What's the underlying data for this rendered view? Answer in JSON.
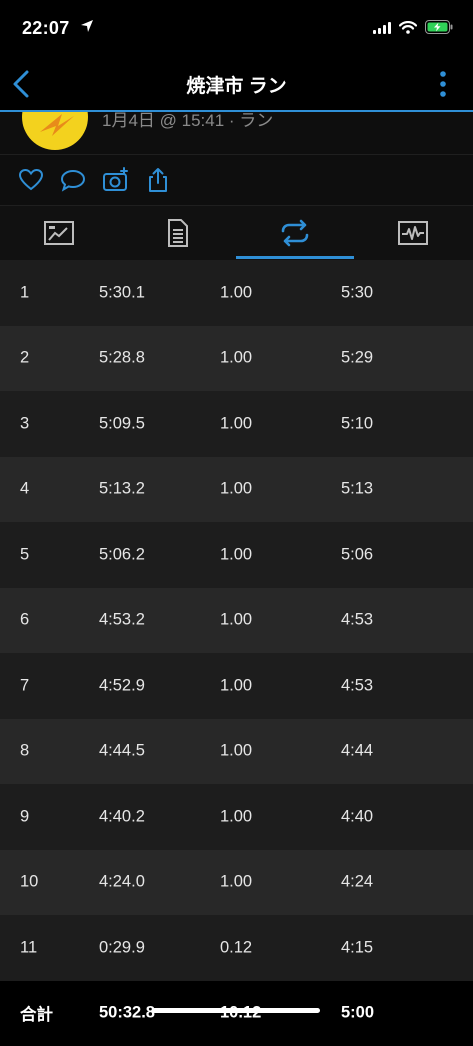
{
  "status": {
    "time": "22:07"
  },
  "nav": {
    "title": "焼津市 ラン"
  },
  "activity": {
    "subtitle": "1月4日 @ 15:41 · ラン"
  },
  "laps": [
    {
      "lap": "1",
      "time": "5:30.1",
      "distance": "1.00",
      "pace": "5:30"
    },
    {
      "lap": "2",
      "time": "5:28.8",
      "distance": "1.00",
      "pace": "5:29"
    },
    {
      "lap": "3",
      "time": "5:09.5",
      "distance": "1.00",
      "pace": "5:10"
    },
    {
      "lap": "4",
      "time": "5:13.2",
      "distance": "1.00",
      "pace": "5:13"
    },
    {
      "lap": "5",
      "time": "5:06.2",
      "distance": "1.00",
      "pace": "5:06"
    },
    {
      "lap": "6",
      "time": "4:53.2",
      "distance": "1.00",
      "pace": "4:53"
    },
    {
      "lap": "7",
      "time": "4:52.9",
      "distance": "1.00",
      "pace": "4:53"
    },
    {
      "lap": "8",
      "time": "4:44.5",
      "distance": "1.00",
      "pace": "4:44"
    },
    {
      "lap": "9",
      "time": "4:40.2",
      "distance": "1.00",
      "pace": "4:40"
    },
    {
      "lap": "10",
      "time": "4:24.0",
      "distance": "1.00",
      "pace": "4:24"
    },
    {
      "lap": "11",
      "time": "0:29.9",
      "distance": "0.12",
      "pace": "4:15"
    }
  ],
  "total": {
    "label": "合計",
    "time": "50:32.8",
    "distance": "10.12",
    "pace": "5:00"
  },
  "icons": {
    "tabs": [
      "summary-icon",
      "details-icon",
      "laps-icon",
      "chart-icon"
    ],
    "actions": [
      "heart-icon",
      "comment-icon",
      "camera-add-icon",
      "share-icon"
    ]
  },
  "colors": {
    "accent": "#2f8fd6",
    "background": "#000000",
    "row_a": "#1d1d1d",
    "row_b": "#282828"
  }
}
